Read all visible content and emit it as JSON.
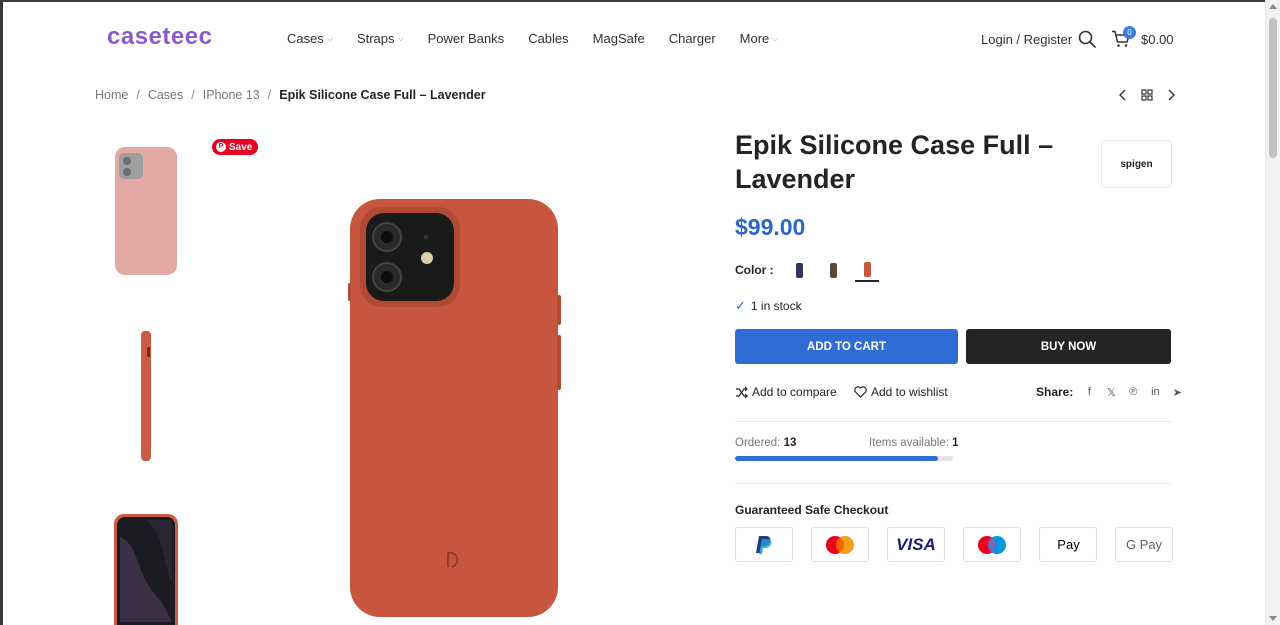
{
  "header": {
    "logo": "caseteec",
    "nav": [
      {
        "label": "Cases",
        "dropdown": true
      },
      {
        "label": "Straps",
        "dropdown": true
      },
      {
        "label": "Power Banks",
        "dropdown": false
      },
      {
        "label": "Cables",
        "dropdown": false
      },
      {
        "label": "MagSafe",
        "dropdown": false
      },
      {
        "label": "Charger",
        "dropdown": false
      },
      {
        "label": "More",
        "dropdown": true
      }
    ],
    "login": "Login / Register",
    "cart_count": "0",
    "cart_total": "$0.00"
  },
  "breadcrumb": {
    "items": [
      "Home",
      "Cases",
      "IPhone 13"
    ],
    "current": "Epik Silicone Case Full – Lavender"
  },
  "gallery": {
    "save_label": "Save"
  },
  "product": {
    "title": "Epik Silicone Case Full – Lavender",
    "brand": "spigen",
    "price": "$99.00",
    "color_label": "Color :",
    "stock": "1 in stock",
    "add_to_cart": "ADD TO CART",
    "buy_now": "BUY NOW",
    "compare": "Add to compare",
    "wishlist": "Add to wishlist",
    "share_label": "Share:",
    "ordered_label": "Ordered:",
    "ordered_value": "13",
    "available_label": "Items available:",
    "available_value": "1",
    "sold_fraction": 0.93,
    "checkout_title": "Guaranteed Safe Checkout",
    "payments": [
      "PayPal",
      "Mastercard",
      "VISA",
      "Maestro",
      "Pay",
      "G Pay"
    ]
  },
  "colors": {
    "accent": "#2f6dd4",
    "logo": "#8b5cc8",
    "case_main": "#c8553e"
  }
}
